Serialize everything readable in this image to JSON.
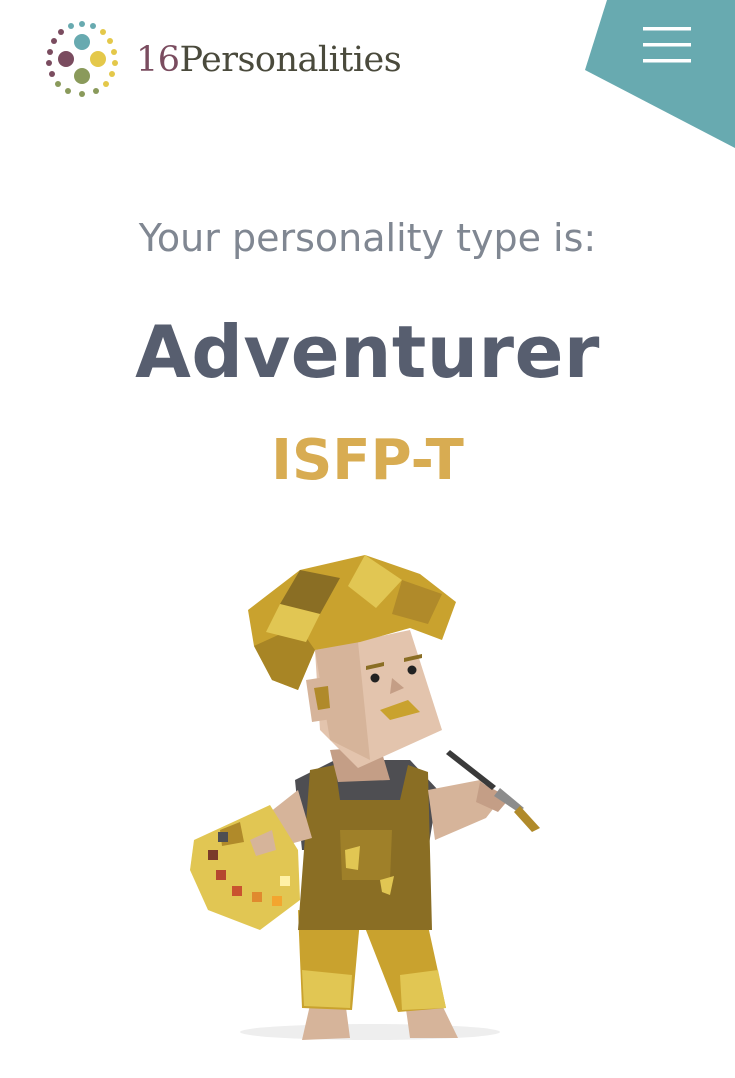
{
  "brand": {
    "number": "16",
    "name": "Personalities",
    "colors": {
      "teal": "#68aab0",
      "plum": "#7a4c5f",
      "gold": "#e4c84a",
      "olive": "#8a9a5b"
    }
  },
  "header": {
    "logo_icon": "dotted-circle-logo-icon",
    "menu_icon": "hamburger-menu-icon",
    "menu_background": "#68aab0"
  },
  "result": {
    "intro": "Your personality type is:",
    "type_name": "Adventurer",
    "type_code": "ISFP-T",
    "type_name_color": "#575e6f",
    "type_code_color": "#d8ac52"
  },
  "illustration": {
    "icon": "adventurer-painter-illustration"
  }
}
